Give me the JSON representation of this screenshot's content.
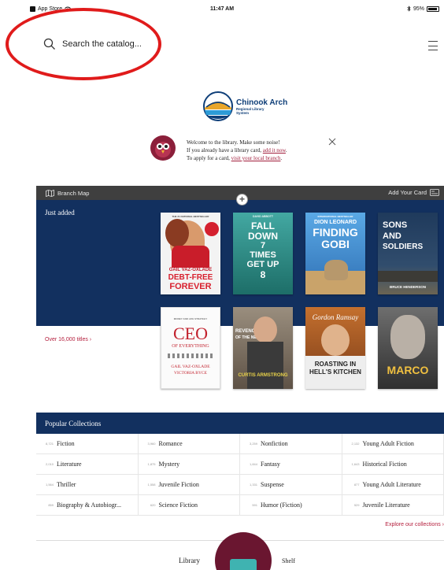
{
  "status": {
    "carrier": "App Store",
    "time": "11:47 AM",
    "battery": "95%",
    "battery_level": 0.95
  },
  "search": {
    "placeholder": "Search the catalog..."
  },
  "logo": {
    "name": "Chinook Arch",
    "sub1": "Regional Library",
    "sub2": "System"
  },
  "welcome": {
    "line1": "Welcome to the library. Make some noise!",
    "line2_prefix": "If you already have a library card, ",
    "line2_link": "add it now",
    "line2_suffix": ".",
    "line3_prefix": "To apply for a card, ",
    "line3_link": "visit your local branch",
    "line3_suffix": "."
  },
  "branchbar": {
    "branch_map": "Branch Map",
    "add_card": "Add Your Card"
  },
  "just_added": {
    "title": "Just added",
    "over_titles": "Over 16,000 titles ›"
  },
  "books": [
    {
      "id": "debt-free-forever",
      "top": "THE #1 NATIONAL BESTSELLER",
      "author": "GAIL VAZ-OXLADE",
      "title1": "DEBT-FREE",
      "title2": "FOREVER"
    },
    {
      "id": "fall-down-7-times",
      "top": "DAVID ABBOTT",
      "title1": "FALL",
      "title2": "DOWN",
      "title3": "7",
      "title4": "TIMES",
      "title5": "GET UP",
      "title6": "8"
    },
    {
      "id": "finding-gobi",
      "top": "INTERNATIONAL BESTSELLER",
      "author": "DION LEONARD",
      "title1": "FINDING",
      "title2": "GOBI"
    },
    {
      "id": "sons-and-soldiers",
      "title1": "SONS",
      "title2": "AND",
      "title3": "SOLDIERS",
      "author": "BRUCE HENDERSON"
    },
    {
      "id": "ceo-of-everything",
      "top": "MONEY AND LIFE STRATEGY",
      "title1": "CEO",
      "title2": "OF EVERYTHING",
      "author1": "GAIL VAZ-OXLADE",
      "author2": "VICTORIA BYCE"
    },
    {
      "id": "revenge-of-the-nerd",
      "title1": "REVENGE",
      "title2": "OF THE NERD",
      "author": "CURTIS ARMSTRONG"
    },
    {
      "id": "roasting-in-hells-kitchen",
      "author": "Gordon Ramsay",
      "title1": "ROASTING IN",
      "title2": "HELL'S KITCHEN"
    },
    {
      "id": "marco",
      "title1": "MARCO"
    }
  ],
  "popular": {
    "title": "Popular Collections",
    "items": [
      {
        "count": "8,721",
        "label": "Fiction"
      },
      {
        "count": "3,960",
        "label": "Romance"
      },
      {
        "count": "3,259",
        "label": "Nonfiction"
      },
      {
        "count": "2,132",
        "label": "Young Adult Fiction"
      },
      {
        "count": "2,010",
        "label": "Literature"
      },
      {
        "count": "1,875",
        "label": "Mystery"
      },
      {
        "count": "1,844",
        "label": "Fantasy"
      },
      {
        "count": "1,643",
        "label": "Historical Fiction"
      },
      {
        "count": "1,564",
        "label": "Thriller"
      },
      {
        "count": "1,558",
        "label": "Juvenile Fiction"
      },
      {
        "count": "1,331",
        "label": "Suspense"
      },
      {
        "count": "877",
        "label": "Young Adult Literature"
      },
      {
        "count": "859",
        "label": "Biography & Autobiogr..."
      },
      {
        "count": "620",
        "label": "Science Fiction"
      },
      {
        "count": "591",
        "label": "Humor (Fiction)"
      },
      {
        "count": "529",
        "label": "Juvenile Literature"
      }
    ],
    "explore": "Explore our collections ›"
  },
  "nav": {
    "library": "Library",
    "shelf": "Shelf"
  },
  "colors": {
    "navy": "#12305f",
    "accent": "#b5213f",
    "owl": "#6a1630"
  }
}
